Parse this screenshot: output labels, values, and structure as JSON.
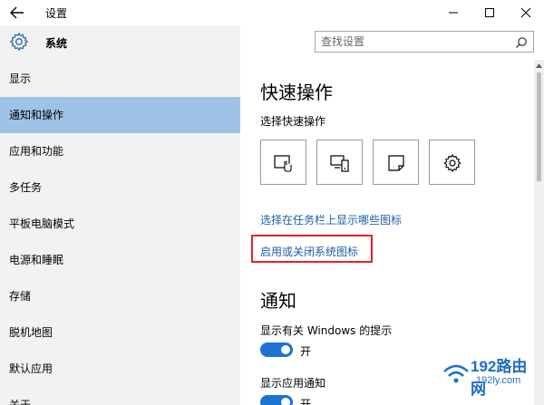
{
  "window": {
    "title": "设置"
  },
  "app": {
    "name": "系统"
  },
  "search": {
    "placeholder": "查找设置"
  },
  "nav": {
    "items": [
      {
        "label": "显示"
      },
      {
        "label": "通知和操作"
      },
      {
        "label": "应用和功能"
      },
      {
        "label": "多任务"
      },
      {
        "label": "平板电脑模式"
      },
      {
        "label": "电源和睡眠"
      },
      {
        "label": "存储"
      },
      {
        "label": "脱机地图"
      },
      {
        "label": "默认应用"
      },
      {
        "label": "关于"
      }
    ],
    "active_index": 1
  },
  "quick_actions": {
    "title": "快速操作",
    "subtitle": "选择快速操作",
    "tiles": [
      "tablet-mode-icon",
      "connect-display-icon",
      "note-icon",
      "settings-gear-icon"
    ]
  },
  "links": {
    "taskbar_icons": "选择在任务栏上显示哪些图标",
    "system_icons": "启用或关闭系统图标"
  },
  "notifications": {
    "title": "通知",
    "tips_label": "显示有关 Windows 的提示",
    "tips_state": "开",
    "app_label": "显示应用通知",
    "app_state": "开"
  },
  "watermark": {
    "name": "192路由网",
    "url": "192ly.com"
  },
  "colors": {
    "accent": "#1a73d0",
    "link": "#1a5fa8",
    "highlight_box": "#e8202a",
    "nav_active": "#9ec3e6",
    "nav_bg": "#f2f2f2"
  }
}
